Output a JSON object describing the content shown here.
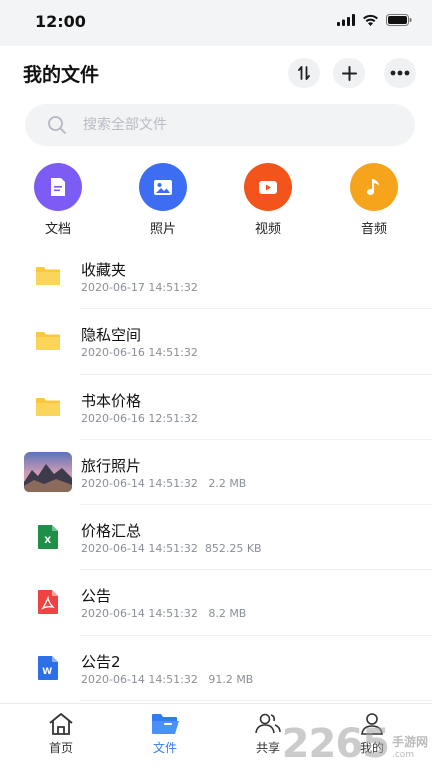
{
  "status_bar": {
    "time": "12:00",
    "icons": [
      "signal-icon",
      "wifi-icon",
      "battery-icon"
    ]
  },
  "header": {
    "title": "我的文件",
    "buttons": [
      "sort-icon",
      "add-icon",
      "more-icon"
    ]
  },
  "search": {
    "placeholder": "搜索全部文件",
    "value": ""
  },
  "categories": [
    {
      "label": "文档",
      "icon": "document-icon",
      "color": "#7c5cf5"
    },
    {
      "label": "照片",
      "icon": "photo-icon",
      "color": "#3d6df2"
    },
    {
      "label": "视频",
      "icon": "video-icon",
      "color": "#f2541b"
    },
    {
      "label": "音频",
      "icon": "music-icon",
      "color": "#f5a41c"
    }
  ],
  "files": [
    {
      "name": "收藏夹",
      "date": "2020-06-17 14:51:32",
      "size": "",
      "icon": "folder-icon"
    },
    {
      "name": "隐私空间",
      "date": "2020-06-16 14:51:32",
      "size": "",
      "icon": "folder-icon"
    },
    {
      "name": "书本价格",
      "date": "2020-06-16 12:51:32",
      "size": "",
      "icon": "folder-icon"
    },
    {
      "name": "旅行照片",
      "date": "2020-06-14 14:51:32",
      "size": "2.2 MB",
      "icon": "photo-thumbnail-icon"
    },
    {
      "name": "价格汇总",
      "date": "2020-06-14 14:51:32",
      "size": "852.25 KB",
      "icon": "excel-file-icon"
    },
    {
      "name": "公告",
      "date": "2020-06-14 14:51:32",
      "size": "8.2 MB",
      "icon": "pdf-file-icon"
    },
    {
      "name": "公告2",
      "date": "2020-06-14 14:51:32",
      "size": "91.2 MB",
      "icon": "word-file-icon"
    }
  ],
  "tabbar": {
    "active": "文件",
    "accent": "#2f7cf6",
    "tabs": [
      {
        "label": "首页",
        "icon": "home-icon"
      },
      {
        "label": "文件",
        "icon": "folder-open-icon"
      },
      {
        "label": "共享",
        "icon": "share-users-icon"
      },
      {
        "label": "我的",
        "icon": "user-icon"
      }
    ]
  },
  "watermark": {
    "number": "2265",
    "text": "手游网",
    "url": ".com"
  }
}
